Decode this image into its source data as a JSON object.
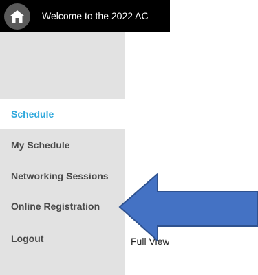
{
  "header": {
    "home_icon": "home-icon",
    "welcome_text": "Welcome to the 2022 AC"
  },
  "sidebar": {
    "items": [
      {
        "label": "Schedule",
        "active": true
      },
      {
        "label": "My Schedule",
        "active": false
      },
      {
        "label": "Networking Sessions",
        "active": false
      },
      {
        "label": "Online Registration",
        "active": false
      },
      {
        "label": "Logout",
        "active": false
      }
    ]
  },
  "main": {
    "fullview_text": "Full View"
  },
  "colors": {
    "active": "#2fa8dc",
    "sidebar_bg": "#e2e2e2",
    "arrow_fill": "#4472c4",
    "arrow_stroke": "#2f528f"
  }
}
